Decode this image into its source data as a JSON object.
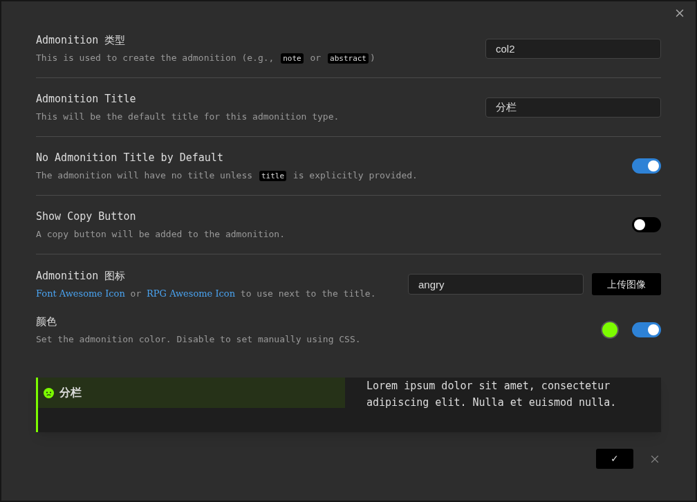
{
  "settings": [
    {
      "kind": "input",
      "title": "Admonition 类型",
      "description": [
        {
          "kind": "text",
          "text": "This is used to create the admonition (e.g., "
        },
        {
          "kind": "code",
          "text": "note"
        },
        {
          "kind": "text",
          "text": " or "
        },
        {
          "kind": "code",
          "text": "abstract"
        },
        {
          "kind": "text",
          "text": ")"
        }
      ],
      "value": "col2"
    },
    {
      "kind": "input",
      "title": "Admonition Title",
      "description": [
        {
          "kind": "text",
          "text": "This will be the default title for this admonition type."
        }
      ],
      "value": "分栏"
    },
    {
      "kind": "toggle",
      "title": "No Admonition Title by Default",
      "description": [
        {
          "kind": "text",
          "text": "The admonition will have no title unless "
        },
        {
          "kind": "code",
          "text": "title"
        },
        {
          "kind": "text",
          "text": " is explicitly provided."
        }
      ],
      "on": true
    },
    {
      "kind": "toggle",
      "title": "Show Copy Button",
      "description": [
        {
          "kind": "text",
          "text": "A copy button will be added to the admonition."
        }
      ],
      "on": false
    },
    {
      "kind": "icon",
      "title": "Admonition 图标",
      "description": [
        {
          "kind": "link",
          "text": "Font Awesome Icon"
        },
        {
          "kind": "text",
          "text": " or "
        },
        {
          "kind": "link",
          "text": "RPG Awesome Icon"
        },
        {
          "kind": "text",
          "text": " to use next to the title."
        }
      ],
      "value": "angry",
      "button": "上传图像"
    },
    {
      "kind": "color",
      "title": "颜色",
      "description": [
        {
          "kind": "text",
          "text": "Set the admonition color. Disable to set manually using CSS."
        }
      ],
      "color": "#7cfc00",
      "on": true
    }
  ],
  "preview": {
    "title": "分栏",
    "color": "#7cfc00",
    "body": "Lorem ipsum dolor sit amet, consectetur adipiscing elit. Nulla et euismod nulla."
  },
  "actions": {
    "confirm": "✓"
  }
}
